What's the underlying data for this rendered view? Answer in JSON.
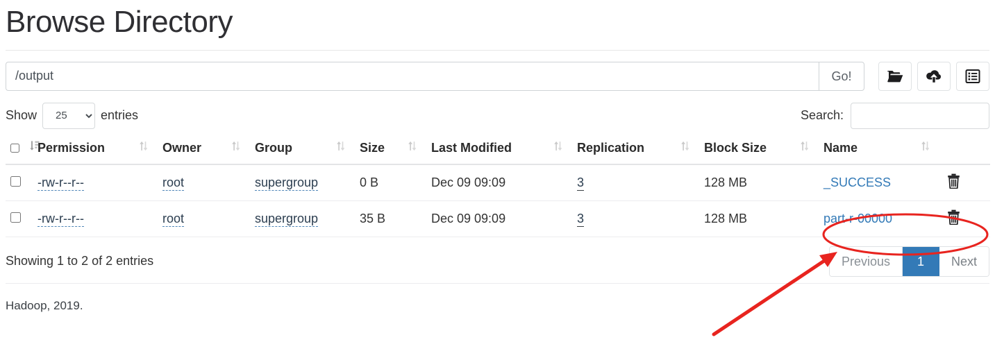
{
  "header": {
    "title": "Browse Directory"
  },
  "path_bar": {
    "value": "/output",
    "placeholder": "",
    "go_label": "Go!",
    "buttons": [
      {
        "name": "new-directory-button",
        "icon": "folder-open-icon"
      },
      {
        "name": "upload-button",
        "icon": "cloud-upload-icon"
      },
      {
        "name": "cut-paste-button",
        "icon": "list-alt-icon"
      }
    ]
  },
  "controls": {
    "show_label": "Show",
    "entries_label": "entries",
    "entries_value": "25",
    "entries_options": [
      "25"
    ],
    "search_label": "Search:",
    "search_value": "",
    "search_placeholder": ""
  },
  "table": {
    "columns": [
      {
        "key": "checkbox",
        "label": "",
        "sort_icon": "sort-amount-down-icon"
      },
      {
        "key": "permission",
        "label": "Permission",
        "sort_icon": "sort-icon"
      },
      {
        "key": "owner",
        "label": "Owner",
        "sort_icon": "sort-icon"
      },
      {
        "key": "group",
        "label": "Group",
        "sort_icon": "sort-icon"
      },
      {
        "key": "size",
        "label": "Size",
        "sort_icon": "sort-icon"
      },
      {
        "key": "last_modified",
        "label": "Last Modified",
        "sort_icon": "sort-icon"
      },
      {
        "key": "replication",
        "label": "Replication",
        "sort_icon": "sort-icon"
      },
      {
        "key": "block_size",
        "label": "Block Size",
        "sort_icon": "sort-icon"
      },
      {
        "key": "name",
        "label": "Name",
        "sort_icon": "sort-icon"
      }
    ],
    "rows": [
      {
        "selected": false,
        "permission": "-rw-r--r--",
        "owner": "root",
        "group": "supergroup",
        "size": "0 B",
        "last_modified": "Dec 09 09:09",
        "replication": "3",
        "block_size": "128 MB",
        "name": "_SUCCESS",
        "delete_icon": "trash-icon"
      },
      {
        "selected": false,
        "permission": "-rw-r--r--",
        "owner": "root",
        "group": "supergroup",
        "size": "35 B",
        "last_modified": "Dec 09 09:09",
        "replication": "3",
        "block_size": "128 MB",
        "name": "part-r-00000",
        "delete_icon": "trash-icon"
      }
    ]
  },
  "footer": {
    "info": "Showing 1 to 2 of 2 entries",
    "pagination": {
      "previous": "Previous",
      "page": "1",
      "next": "Next"
    },
    "copyright": "Hadoop, 2019."
  },
  "annotations": {
    "highlight_color": "#e8241f",
    "ellipse_target": "part-r-00000",
    "arrow": "points-to-part-r-00000"
  },
  "colors": {
    "link": "#337ab7",
    "active_page": "#337ab7",
    "text": "#333333",
    "annotation": "#e8241f"
  }
}
